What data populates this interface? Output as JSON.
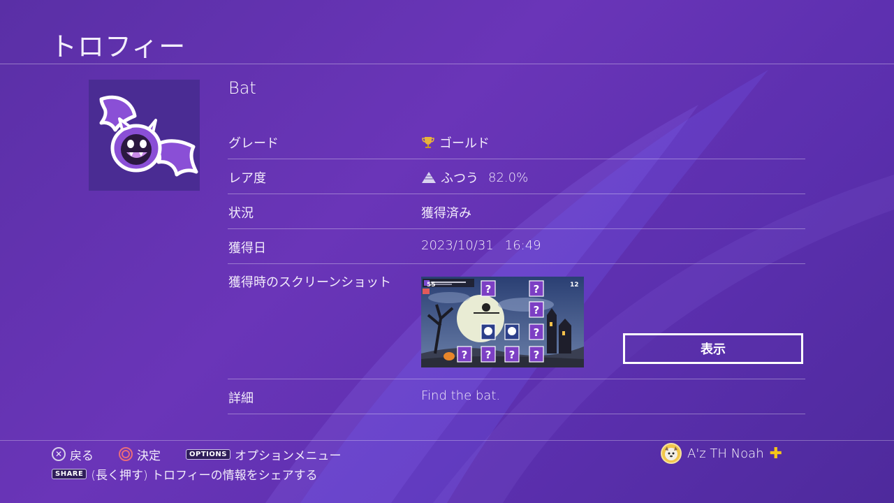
{
  "page": {
    "title": "トロフィー"
  },
  "trophy": {
    "name": "Bat",
    "rows": {
      "grade": {
        "label": "グレード",
        "value": "ゴールド"
      },
      "rarity": {
        "label": "レア度",
        "value": "ふつう",
        "percent": "82.0%"
      },
      "status": {
        "label": "状況",
        "value": "獲得済み"
      },
      "date": {
        "label": "獲得日",
        "value": "2023/10/31",
        "time": "16:49"
      },
      "screenshot": {
        "label": "獲得時のスクリーンショット",
        "button": "表示"
      },
      "detail": {
        "label": "詳細",
        "value": "Find the bat."
      }
    }
  },
  "screenshot_overlay": {
    "score_left": "55",
    "score_right": "12"
  },
  "footer": {
    "back_label": "戻る",
    "confirm_label": "決定",
    "options_key": "OPTIONS",
    "options_label": "オプションメニュー",
    "share_key": "SHARE",
    "share_label": "(長く押す) トロフィーの情報をシェアする"
  },
  "user": {
    "name": "A'z TH Noah"
  },
  "colors": {
    "accent_gold": "#f5c518",
    "background": "#5a2fa6"
  }
}
